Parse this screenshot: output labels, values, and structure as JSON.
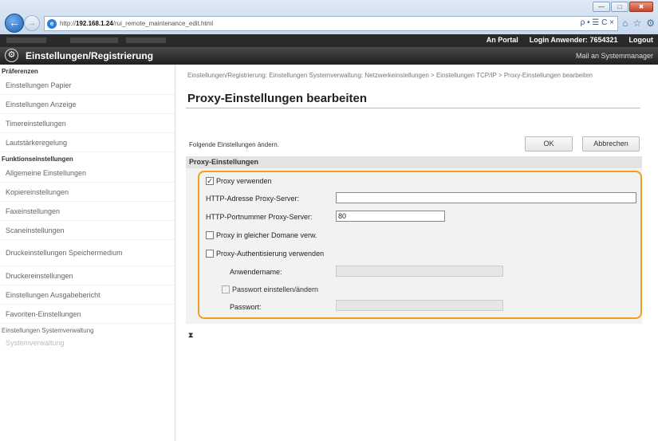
{
  "browser": {
    "url_prefix": "http://",
    "url_host": "192.168.1.24",
    "url_path": "/rui_remote_maintenance_edit.html",
    "search_controls": "ρ • ☰ C ×",
    "min_label": "—",
    "max_label": "□",
    "close_label": "✖"
  },
  "topbar": {
    "portal_link": "An Portal",
    "login_label": "Login Anwender:",
    "login_user": "7654321",
    "logout_link": "Logout"
  },
  "header": {
    "title": "Einstellungen/Registrierung",
    "mail_link": "Mail an Systemmanager"
  },
  "sidebar": {
    "section_prefs": "Präferenzen",
    "prefs_items": [
      "Einstellungen Papier",
      "Einstellungen Anzeige",
      "Timereinstellungen",
      "Lautstärkeregelung"
    ],
    "section_functions": "Funktionseinstellungen",
    "function_items": [
      "Allgemeine Einstellungen",
      "Kopiereinstellungen",
      "Faxeinstellungen",
      "Scaneinstellungen",
      "Druckeinstellungen Speichermedium",
      "Druckereinstellungen",
      "Einstellungen Ausgabebericht",
      "Favoriten-Einstellungen"
    ],
    "section_system": "Einstellungen Systemverwaltung",
    "system_item": "Systemverwaltung"
  },
  "main": {
    "breadcrumb": "Einstellungen/Registrierung: Einstellungen Systemverwaltung: Netzwerkeinstellungen > Einstellungen TCP/IP > Proxy-Einstellungen bearbeiten",
    "title": "Proxy-Einstellungen bearbeiten",
    "instruction": "Folgende Einstellungen ändern.",
    "ok_label": "OK",
    "cancel_label": "Abbrechen",
    "section_title": "Proxy-Einstellungen",
    "use_proxy_label": "Proxy verwenden",
    "use_proxy_checked": "✓",
    "http_address_label": "HTTP-Adresse Proxy-Server:",
    "http_address_value": "",
    "http_port_label": "HTTP-Portnummer Proxy-Server:",
    "http_port_value": "80",
    "same_domain_label": "Proxy in gleicher Domane verw.",
    "auth_label": "Proxy-Authentisierung verwenden",
    "username_label": "Anwendername:",
    "username_value": "",
    "set_password_label": "Passwort einstellen/ändern",
    "password_label": "Passwort:",
    "password_value": "",
    "collapse_glyph": "⧗"
  }
}
